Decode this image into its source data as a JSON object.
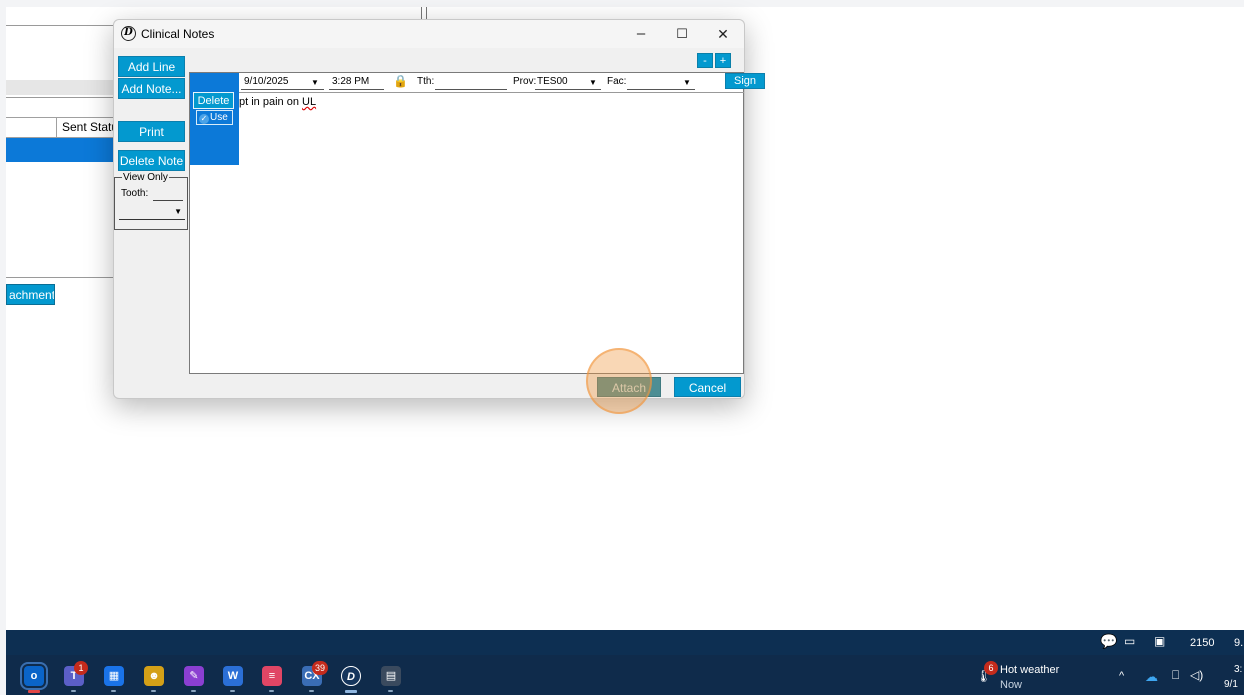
{
  "background_app": {
    "header_cell": "Sent Statu",
    "attachment_button": "achment"
  },
  "dialog": {
    "title": "Clinical Notes",
    "window_controls": {
      "minimize": "–",
      "maximize": "☐",
      "close": "✕"
    },
    "side_buttons": {
      "add_line": "Add Line",
      "add_note": "Add Note...",
      "print": "Print",
      "delete_note": "Delete Note"
    },
    "view_only": {
      "legend": "View Only",
      "tooth_label": "Tooth:",
      "dropdown_arrow": "▼"
    },
    "zoom": {
      "minus": "-",
      "plus": "+"
    },
    "note": {
      "delete_label": "Delete",
      "use_label": "Use",
      "use_checked": true,
      "date": "9/10/2025",
      "date_arrow": "▼",
      "time": "3:28 PM",
      "lock_icon": "lock-icon",
      "tooth_label": "Tth:",
      "tooth_value": "",
      "provider_label": "Prov:",
      "provider_value": "TES00",
      "provider_arrow": "▼",
      "facility_label": "Fac:",
      "facility_value": "",
      "facility_arrow": "▼",
      "sign_label": "Sign",
      "text_prefix": "pt in pain on ",
      "text_misspelled": "UL"
    },
    "attach_label": "Attach",
    "cancel_label": "Cancel"
  },
  "taskbar": {
    "apps": [
      {
        "name": "outlook",
        "glyph": "o",
        "color": "#0a64c8",
        "active": true
      },
      {
        "name": "teams",
        "glyph": "T",
        "color": "#5b5fc7",
        "badge": "1"
      },
      {
        "name": "store",
        "glyph": "▦",
        "color": "#1a73e8"
      },
      {
        "name": "game",
        "glyph": "☻",
        "color": "#d4a017"
      },
      {
        "name": "sketch",
        "glyph": "✎",
        "color": "#8b3fd1"
      },
      {
        "name": "word",
        "glyph": "W",
        "color": "#2b6fd6"
      },
      {
        "name": "tasks",
        "glyph": "≡",
        "color": "#e04665"
      },
      {
        "name": "ticket",
        "glyph": "CX",
        "color": "#3a6db5",
        "badge": "39"
      },
      {
        "name": "dentrix",
        "glyph": "D",
        "color": "#15355c",
        "active": true
      },
      {
        "name": "calculator",
        "glyph": "▤",
        "color": "#3a4a5e"
      }
    ],
    "weather": {
      "badge": "6",
      "title": "Hot weather",
      "subtitle": "Now"
    },
    "top_strip": {
      "count": "2150",
      "date_fragment": "9."
    },
    "tray": {
      "time_fragment": "3:",
      "date_fragment": "9/1"
    }
  }
}
